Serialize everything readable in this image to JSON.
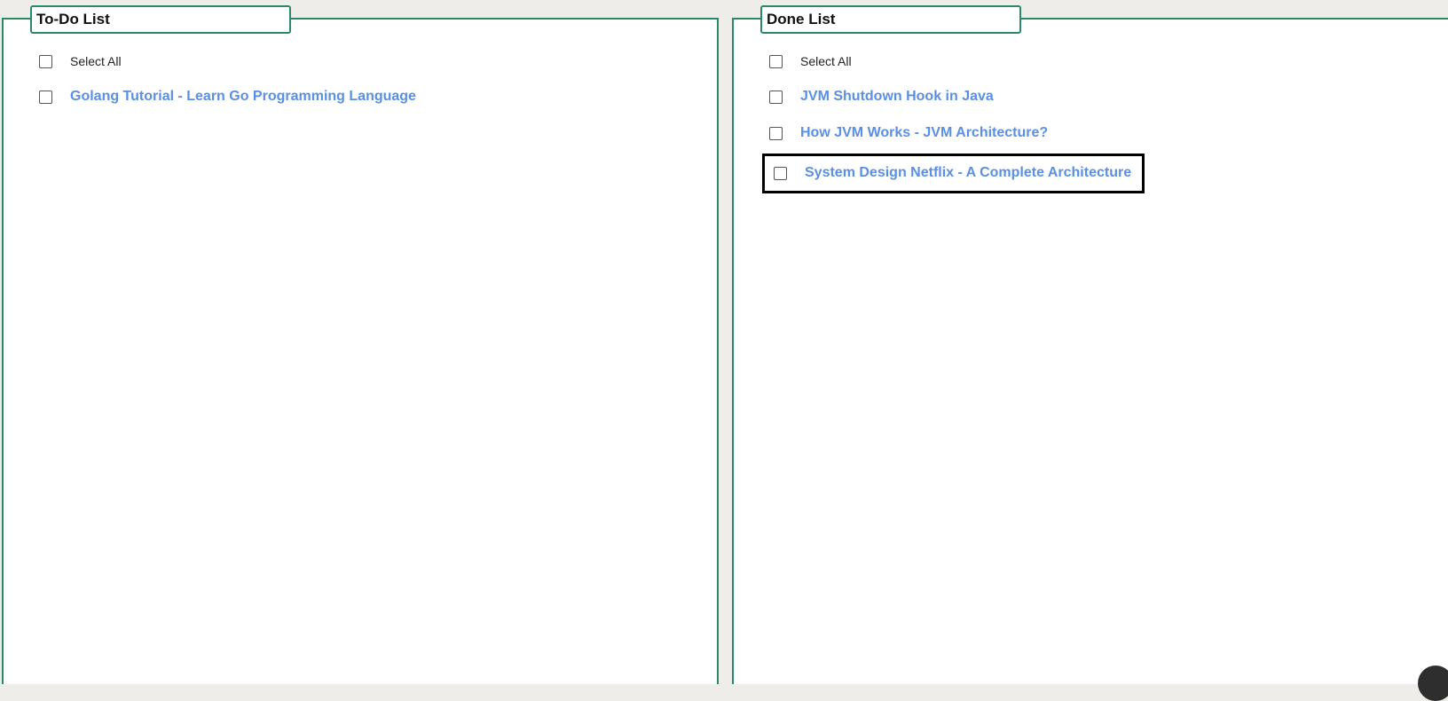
{
  "todo": {
    "title": "To-Do List",
    "select_all": "Select All",
    "items": [
      {
        "label": "Golang Tutorial - Learn Go Programming Language",
        "checked": false
      }
    ]
  },
  "done": {
    "title": "Done List",
    "select_all": "Select All",
    "items": [
      {
        "label": "JVM Shutdown Hook in Java",
        "checked": false
      },
      {
        "label": "How JVM Works - JVM Architecture?",
        "checked": false
      },
      {
        "label": "System Design Netflix - A Complete Architecture",
        "checked": false,
        "highlighted": true
      }
    ]
  },
  "colors": {
    "panel_border": "#2a8a68",
    "link": "#5a8fe6",
    "background": "#efedea",
    "highlight_border": "#000000"
  }
}
